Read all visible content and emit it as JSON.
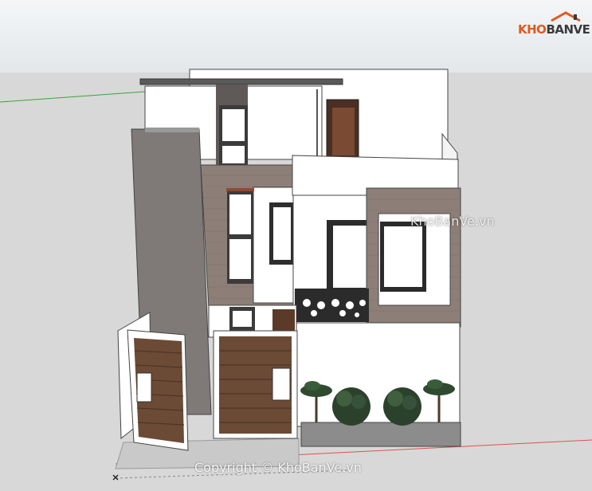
{
  "brand": {
    "logo_part1": "KHO",
    "logo_part2": "BANVE",
    "logo_full": "KHOBANVE"
  },
  "watermarks": {
    "center": "KhoBanVe.vn",
    "footer": "Copyright © KhoBanVe.vn"
  },
  "colors": {
    "sky": "#eef1f3",
    "ground": "#d8d8d8",
    "wall_white": "#ffffff",
    "wall_grey": "#807a76",
    "wood_panel": "#8d7f78",
    "gate_wood": "#6b4a36",
    "axis_red": "#e05050",
    "axis_green": "#3ca33c",
    "logo_orange": "#e05a1e"
  },
  "icons": [
    "house-roof-icon",
    "model-axis-origin-icon"
  ]
}
